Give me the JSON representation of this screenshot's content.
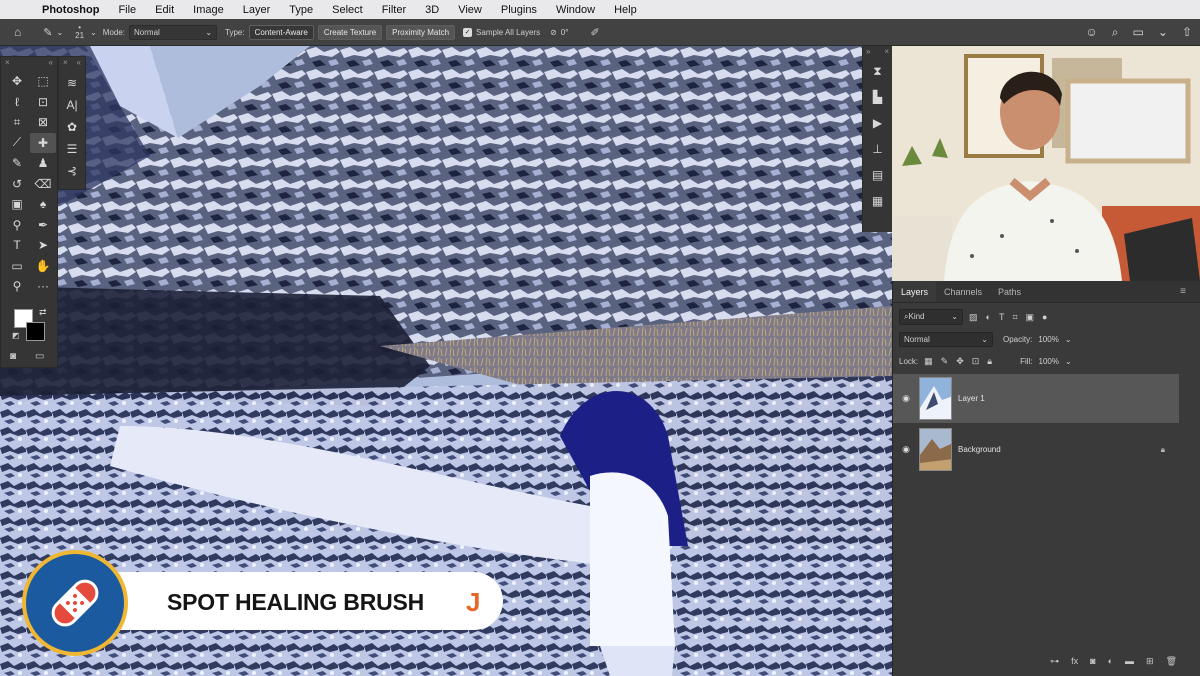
{
  "menubar": {
    "app": "Photoshop",
    "items": [
      "File",
      "Edit",
      "Image",
      "Layer",
      "Type",
      "Select",
      "Filter",
      "3D",
      "View",
      "Plugins",
      "Window",
      "Help"
    ]
  },
  "options": {
    "brush_size": "21",
    "mode_label": "Mode:",
    "mode_value": "Normal",
    "type_label": "Type:",
    "type_buttons": [
      "Content-Aware",
      "Create Texture",
      "Proximity Match"
    ],
    "sample_all_layers": "Sample All Layers",
    "angle": "0°"
  },
  "layers_panel": {
    "tabs": [
      "Layers",
      "Channels",
      "Paths"
    ],
    "filter_kind": "Kind",
    "blend_mode": "Normal",
    "opacity_label": "Opacity:",
    "opacity_value": "100%",
    "lock_label": "Lock:",
    "fill_label": "Fill:",
    "fill_value": "100%",
    "layers": [
      {
        "name": "Layer 1",
        "selected": true
      },
      {
        "name": "Background",
        "selected": false,
        "locked": true
      }
    ]
  },
  "lower_third": {
    "title": "SPOT HEALING BRUSH",
    "shortcut": "J"
  },
  "colors": {
    "accent": "#e6672a",
    "badge_blue": "#1c5aa0",
    "badge_ring": "#f0b732"
  }
}
